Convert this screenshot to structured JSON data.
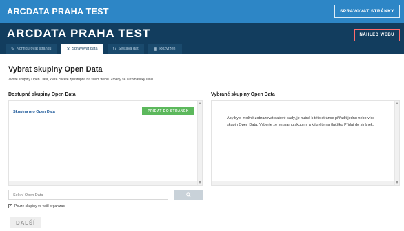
{
  "topbar": {
    "brand": "ARCDATA PRAHA TEST",
    "manage_sites_label": "SPRAVOVAT STRÁNKY"
  },
  "header": {
    "title": "ARCDATA PRAHA TEST",
    "preview_label": "NÁHLED WEBU",
    "tabs": [
      {
        "label": "Konfigurovat stránku",
        "icon": "wrench-icon",
        "active": false
      },
      {
        "label": "Spravovat data",
        "icon": "tools-icon",
        "active": true
      },
      {
        "label": "Sestava dat",
        "icon": "refresh-icon",
        "active": false
      },
      {
        "label": "Rozvržení",
        "icon": "grid-icon",
        "active": false
      }
    ]
  },
  "main": {
    "heading": "Vybrat skupiny Open Data",
    "subtitle": "Zvolte skupiny Open Data, které chcete zpřístupnit na svém webu. Změny se automaticky uloží.",
    "available": {
      "title": "Dostupné skupiny Open Data",
      "groups": [
        {
          "name": "Skupina pro Open Data",
          "add_label": "PŘIDAT DO STRÁNEK"
        }
      ]
    },
    "selected": {
      "title": "Vybrané skupiny Open Data",
      "empty_message": "Aby bylo možné zobrazovat datové sady, je nutné k této stránce přiřadit jednu nebo více skupin Open Data. Vyberte ze seznamu skupiny a klikněte na tlačítko Přidat do stránek."
    },
    "search": {
      "placeholder": "Selkní Open Data"
    },
    "checkbox": {
      "label": "Pouze skupiny ve vaší organizaci",
      "checked": true
    },
    "next_label": "DALŠÍ"
  },
  "colors": {
    "topbar": "#2d86c6",
    "header": "#123d5e",
    "add_button": "#5cb85c",
    "preview_border": "#ff6b6b"
  }
}
